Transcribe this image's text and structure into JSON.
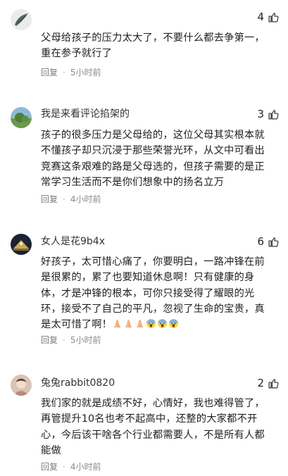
{
  "colors": {
    "text": "#1f1f1f",
    "meta": "#8a8a8a",
    "username": "#333333"
  },
  "icons": {
    "like": "thumbs-up-outline-icon"
  },
  "comments": [
    {
      "username": "",
      "likes": "4",
      "text": "父母给孩子的压力太大了，不要什么都去争第一，重在参予就行了",
      "reply": "回复",
      "time": "5小时前"
    },
    {
      "username": "我是来看评论掐架的",
      "likes": "3",
      "text": "孩子的很多压力是父母给的，这位父母其实根本就不懂孩子却只沉浸于那些荣誉光环，从文中可看出竞赛这条艰难的路是父母选的，但孩子需要的是正常学习生活而不是你们想象中的扬名立万",
      "reply": "回复",
      "time": "4小时前"
    },
    {
      "username": "女人是花9b4x",
      "likes": "6",
      "text": "好孩子，太可惜心痛了，你要明白，一路冲锋在前是很累的，累了也要知道休息啊！只有健康的身体，才是冲锋的根本，可你只接受得了耀眼的光环，接受不了自己的平凡，忽视了生命的宝贵，真是太可惜了啊！",
      "emojis": [
        "praying-hands-emoji",
        "praying-hands-emoji",
        "praying-hands-emoji",
        "screaming-face-emoji",
        "screaming-face-emoji",
        "screaming-face-emoji"
      ],
      "reply": "回复",
      "time": "5小时前"
    },
    {
      "username": "兔兔rabbit0820",
      "likes": "2",
      "text": "我们家的就是成绩不好，心情好，我也难得管了，再管提升10名也考不起高中，还整的大家都不开心，今后该干啥各个行业都需要人，不是所有人都能做",
      "reply": "回复",
      "time": "4小时前"
    }
  ]
}
